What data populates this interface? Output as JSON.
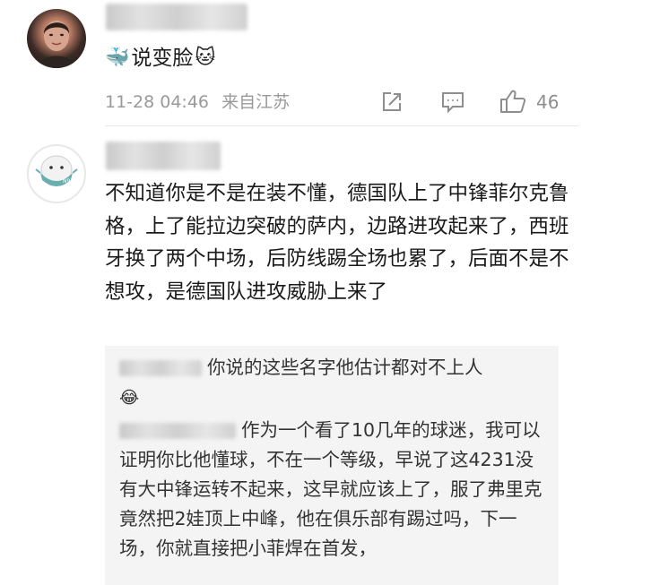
{
  "comment1": {
    "text": "说变脸",
    "whale_emoji": "🐳",
    "cat_emoji": "🐱",
    "timestamp": "11-28 04:46",
    "location": "来自江苏",
    "likes": "46",
    "icons": [
      "share-icon",
      "comment-icon",
      "like-icon"
    ]
  },
  "comment2": {
    "text": "不知道你是不是在装不懂，德国队上了中锋菲尔克鲁格，上了能拉边突破的萨内，边路进攻起来了，西班牙换了两个中场，后防线踢全场也累了，后面不是不想攻，是德国队进攻威胁上来了",
    "replies": [
      {
        "text": "你说的这些名字他估计都对不上人",
        "emoji": "😂"
      },
      {
        "text": "作为一个看了10几年的球迷，我可以证明你比他懂球，不在一个等级，早说了这4231没有大中锋运转不起来，这早就应该上了，服了弗里克竟然把2娃顶上中峰，他在俱乐部有踢过吗，下一场，你就直接把小菲焊在首发，"
      }
    ]
  },
  "colors": {
    "meta_gray": "#9a9a9a",
    "reply_bg": "#f4f4f4",
    "mask_teal": "#6aaeb0"
  }
}
